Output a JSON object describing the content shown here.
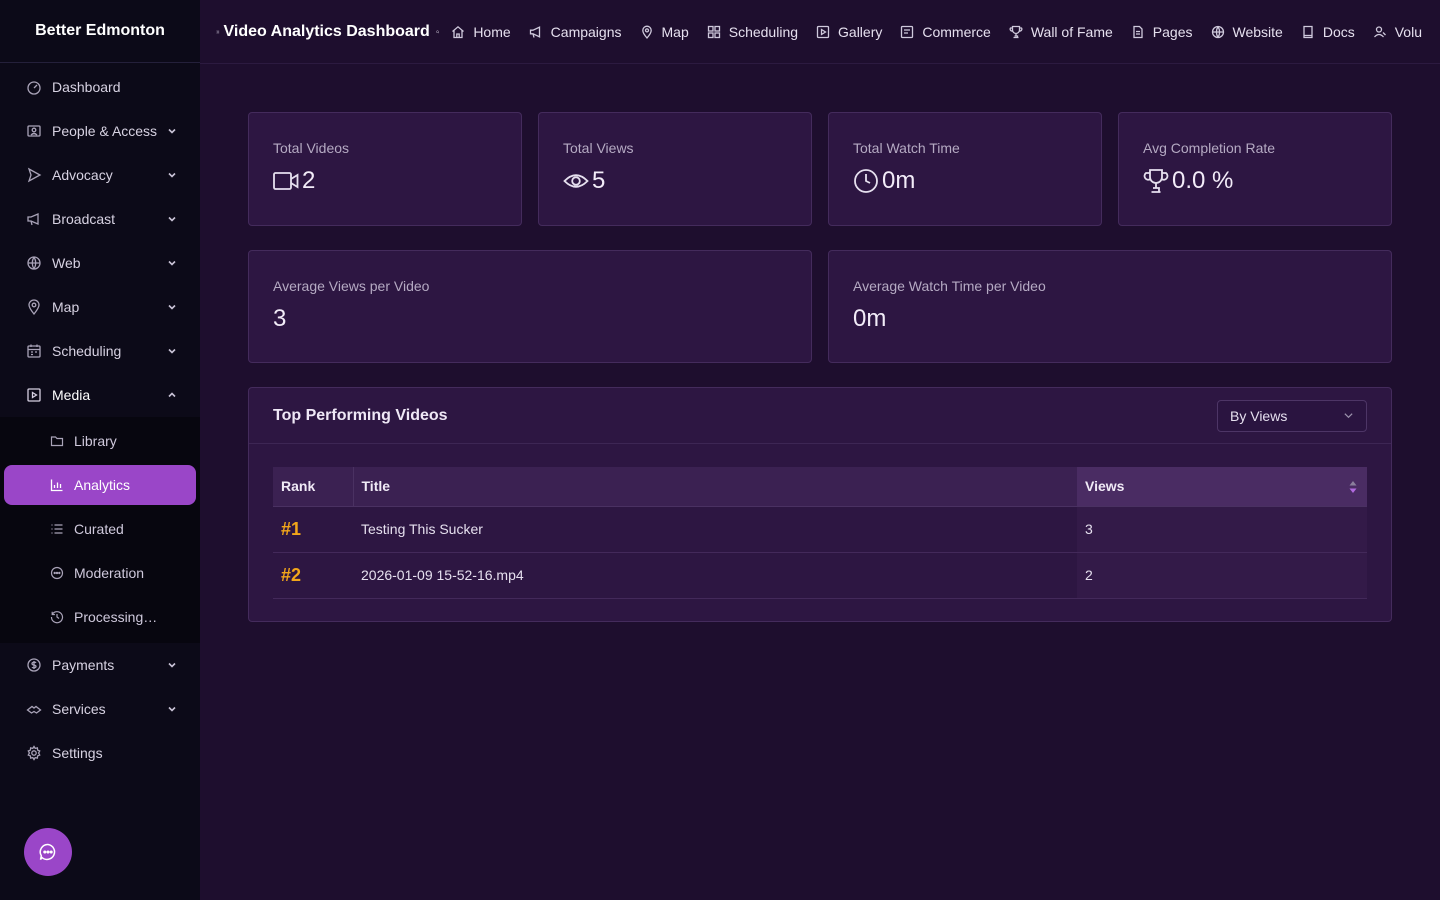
{
  "sidebar": {
    "brand": "Better Edmonton",
    "items": [
      {
        "label": "Dashboard",
        "icon": "dashboard-icon"
      },
      {
        "label": "People & Access",
        "icon": "people-icon"
      },
      {
        "label": "Advocacy",
        "icon": "send-icon"
      },
      {
        "label": "Broadcast",
        "icon": "megaphone-icon"
      },
      {
        "label": "Web",
        "icon": "globe-icon"
      },
      {
        "label": "Map",
        "icon": "map-pin-icon"
      },
      {
        "label": "Scheduling",
        "icon": "calendar-icon"
      },
      {
        "label": "Media",
        "icon": "media-icon"
      },
      {
        "label": "Payments",
        "icon": "dollar-icon"
      },
      {
        "label": "Services",
        "icon": "services-icon"
      },
      {
        "label": "Settings",
        "icon": "gear-icon"
      }
    ],
    "media_sub": [
      {
        "label": "Library",
        "icon": "folder-icon"
      },
      {
        "label": "Analytics",
        "icon": "bar-chart-icon"
      },
      {
        "label": "Curated",
        "icon": "list-icon"
      },
      {
        "label": "Moderation",
        "icon": "moderation-icon"
      },
      {
        "label": "Processing…",
        "icon": "history-icon"
      }
    ],
    "active_sub": "Analytics"
  },
  "topbar": {
    "title": "Video Analytics Dashboard",
    "links": [
      {
        "label": "Home",
        "icon": "home-icon"
      },
      {
        "label": "Campaigns",
        "icon": "megaphone-icon"
      },
      {
        "label": "Map",
        "icon": "map-pin-icon"
      },
      {
        "label": "Scheduling",
        "icon": "grid-icon"
      },
      {
        "label": "Gallery",
        "icon": "play-square-icon"
      },
      {
        "label": "Commerce",
        "icon": "commerce-icon"
      },
      {
        "label": "Wall of Fame",
        "icon": "trophy-icon"
      },
      {
        "label": "Pages",
        "icon": "file-icon"
      },
      {
        "label": "Website",
        "icon": "globe-icon"
      },
      {
        "label": "Docs",
        "icon": "doc-icon"
      },
      {
        "label": "Volu",
        "icon": "user-icon"
      }
    ]
  },
  "stats": [
    {
      "label": "Total Videos",
      "value": "2",
      "icon": "video-camera-icon"
    },
    {
      "label": "Total Views",
      "value": "5",
      "icon": "eye-icon"
    },
    {
      "label": "Total Watch Time",
      "value": "0m",
      "icon": "clock-icon"
    },
    {
      "label": "Avg Completion Rate",
      "value": "0.0 %",
      "icon": "trophy-icon"
    }
  ],
  "averages": [
    {
      "label": "Average Views per Video",
      "value": "3"
    },
    {
      "label": "Average Watch Time per Video",
      "value": "0m"
    }
  ],
  "top_videos": {
    "title": "Top Performing Videos",
    "sort_select": "By Views",
    "columns": [
      "Rank",
      "Title",
      "Views"
    ],
    "rows": [
      {
        "rank": "#1",
        "title": "Testing This Sucker",
        "views": "3"
      },
      {
        "rank": "#2",
        "title": "2026-01-09 15-52-16.mp4",
        "views": "2"
      }
    ]
  },
  "colors": {
    "accent": "#9a46c8",
    "rank": "#f2a61a",
    "background": "#1e0e2e",
    "sidebar": "#0c0a18",
    "card": "#2d1642"
  }
}
